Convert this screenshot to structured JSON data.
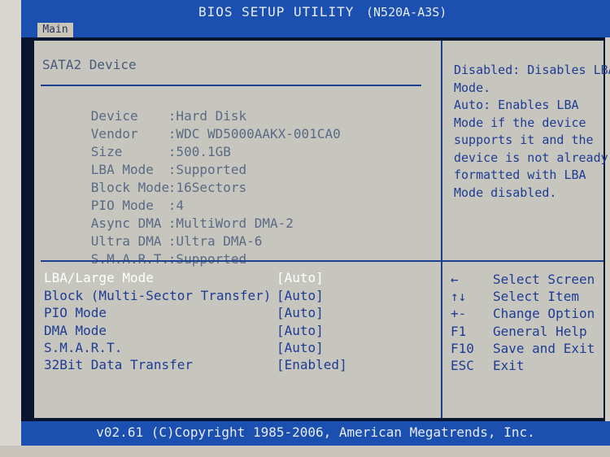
{
  "header": {
    "title": "BIOS SETUP UTILITY",
    "model": "(N520A-A3S)"
  },
  "menu": {
    "main_tab": "Main"
  },
  "section": {
    "title": "SATA2 Device"
  },
  "device_info": [
    {
      "label": "Device",
      "value": ":Hard Disk"
    },
    {
      "label": "Vendor",
      "value": ":WDC WD5000AAKX-001CA0"
    },
    {
      "label": "Size",
      "value": ":500.1GB"
    },
    {
      "label": "LBA Mode",
      "value": ":Supported"
    },
    {
      "label": "Block Mode",
      "value": ":16Sectors"
    },
    {
      "label": "PIO Mode",
      "value": ":4"
    },
    {
      "label": "Async DMA",
      "value": ":MultiWord DMA-2"
    },
    {
      "label": "Ultra DMA",
      "value": ":Ultra DMA-6"
    },
    {
      "label": "S.M.A.R.T.",
      "value": ":Supported"
    }
  ],
  "options": [
    {
      "label": "LBA/Large Mode",
      "value": "[Auto]"
    },
    {
      "label": "Block (Multi-Sector Transfer)",
      "value": "[Auto]"
    },
    {
      "label": "PIO Mode",
      "value": "[Auto]"
    },
    {
      "label": "DMA Mode",
      "value": "[Auto]"
    },
    {
      "label": "S.M.A.R.T.",
      "value": "[Auto]"
    },
    {
      "label": "32Bit Data Transfer",
      "value": "[Enabled]"
    }
  ],
  "help": {
    "lines": [
      "Disabled: Disables LBA",
      "Mode.",
      "Auto: Enables LBA",
      "Mode if the device",
      "supports it and the",
      "device is not already",
      "formatted with LBA",
      "Mode disabled."
    ]
  },
  "keys": [
    {
      "key": "←",
      "desc": "Select Screen"
    },
    {
      "key": "↑↓",
      "desc": "Select Item"
    },
    {
      "key": "+-",
      "desc": "Change Option"
    },
    {
      "key": "F1",
      "desc": "General Help"
    },
    {
      "key": "F10",
      "desc": "Save and Exit"
    },
    {
      "key": "ESC",
      "desc": "Exit"
    }
  ],
  "footer": {
    "copyright": "v02.61 (C)Copyright 1985-2006, American Megatrends, Inc."
  }
}
